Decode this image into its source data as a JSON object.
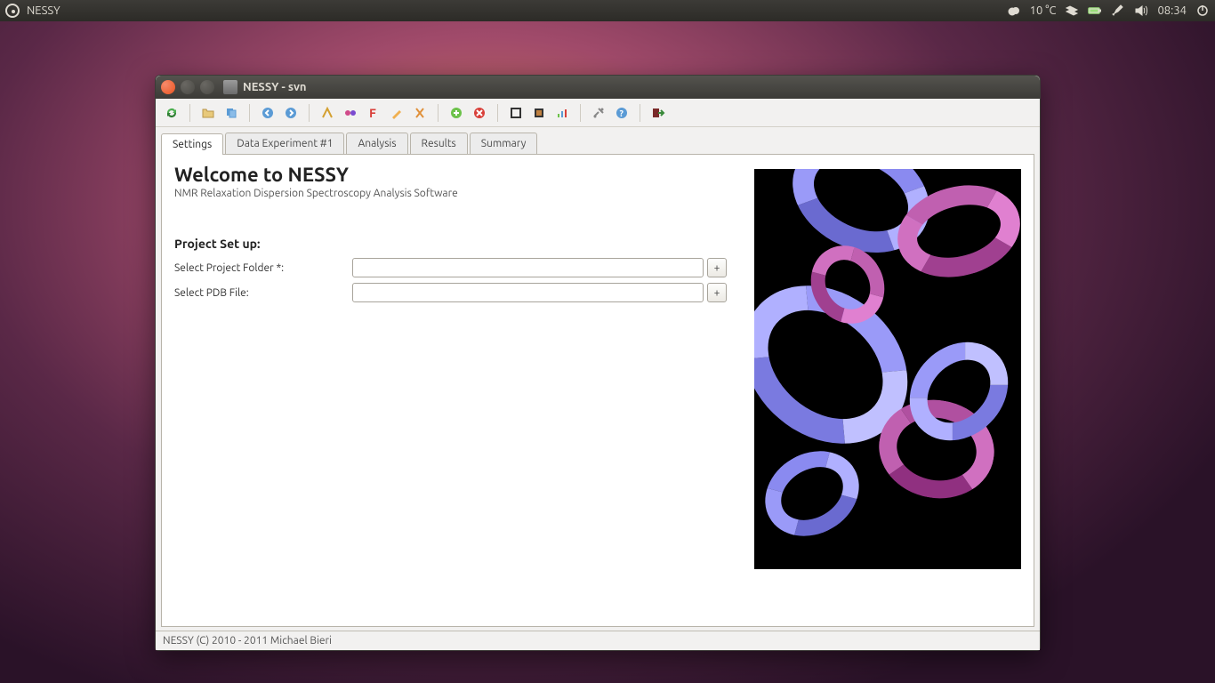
{
  "panel": {
    "app_name": "NESSY",
    "temperature": "10 °C",
    "time": "08:34"
  },
  "window": {
    "title": "NESSY - svn"
  },
  "tabs": [
    {
      "label": "Settings"
    },
    {
      "label": "Data Experiment #1"
    },
    {
      "label": "Analysis"
    },
    {
      "label": "Results"
    },
    {
      "label": "Summary"
    }
  ],
  "settings_page": {
    "heading": "Welcome to NESSY",
    "subtitle": "NMR Relaxation Dispersion Spectroscopy Analysis Software",
    "section": "Project Set up:",
    "project_folder_label": "Select Project Folder *:",
    "project_folder_value": "",
    "pdb_file_label": "Select PDB File:",
    "pdb_file_value": "",
    "browse_label": "+"
  },
  "statusbar": "NESSY (C) 2010 - 2011 Michael Bieri"
}
